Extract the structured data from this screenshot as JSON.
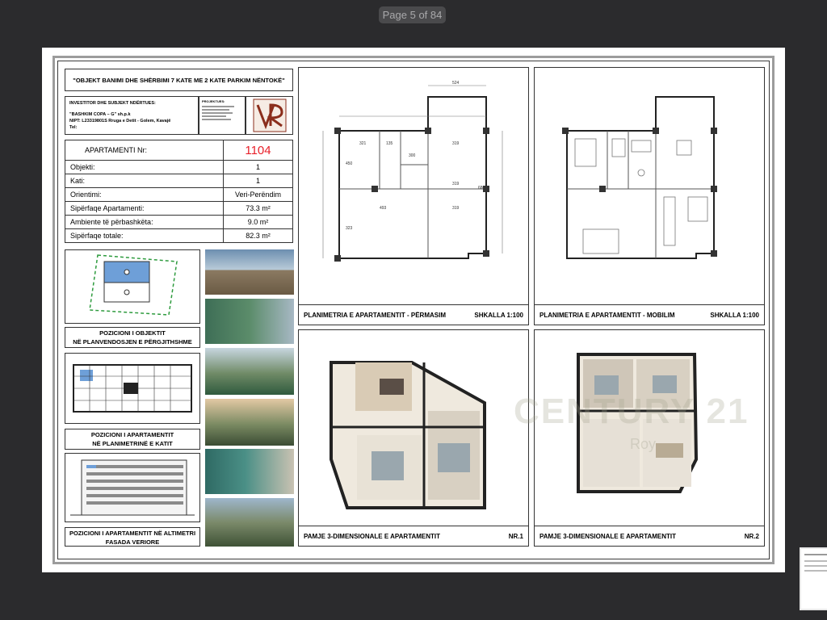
{
  "viewer": {
    "page_indicator": "Page 5 of 84"
  },
  "sheet": {
    "title": "\"OBJEKT BANIMI DHE SHËRBIMI 7 KATE ME 2 KATE PARKIM NËNTOKË\"",
    "investor": {
      "heading": "INVESTITOR DHE SUBJEKT NDËRTUES:",
      "name": "\"BASHKIM COPA – G\" sh.p.k",
      "nipt": "NIPT: L23319801S Rruga e Detit - Golem, Kavajë",
      "tel": "Tel:"
    },
    "designer": {
      "heading": "PROJEKTUES:"
    },
    "info": [
      {
        "label": "APARTAMENTI Nr:",
        "value": "1104"
      },
      {
        "label": "Objekti:",
        "value": "1"
      },
      {
        "label": "Kati:",
        "value": "1"
      },
      {
        "label": "Orientimi:",
        "value": "Veri-Perëndim"
      },
      {
        "label": "Sipërfaqe Apartamenti:",
        "value": "73.3 m²"
      },
      {
        "label": "Ambiente të përbashkëta:",
        "value": "9.0 m²"
      },
      {
        "label": "Sipërfaqe totale:",
        "value": "82.3 m²"
      }
    ],
    "captions": {
      "object_position": [
        "POZICIONI I OBJEKTIT",
        "NË PLANVENDOSJEN E PËRGJITHSHME"
      ],
      "apartment_plan_position": [
        "POZICIONI I APARTAMENTIT",
        "NË PLANIMETRINË E KATIT"
      ],
      "apartment_elevation_position": [
        "POZICIONI I APARTAMENTIT NË ALTIMETRI",
        "FASADA VERIORE"
      ]
    },
    "panels": [
      {
        "title": "PLANIMETRIA E APARTAMENTIT - PËRMASIM",
        "tag": "SHKALLA 1:100"
      },
      {
        "title": "PLANIMETRIA E APARTAMENTIT - MOBILIM",
        "tag": "SHKALLA 1:100"
      },
      {
        "title": "PAMJE 3-DIMENSIONALE E APARTAMENTIT",
        "tag": "NR.1"
      },
      {
        "title": "PAMJE 3-DIMENSIONALE E APARTAMENTIT",
        "tag": "NR.2"
      }
    ],
    "dimensions": [
      "524",
      "321",
      "135",
      "319",
      "450",
      "300",
      "680",
      "319",
      "493",
      "323",
      "319"
    ],
    "watermark": {
      "text": "CENTURY 21",
      "sub": "Roy"
    }
  },
  "colors": {
    "background": "#2b2b2d",
    "accent_red": "#e8202a"
  }
}
